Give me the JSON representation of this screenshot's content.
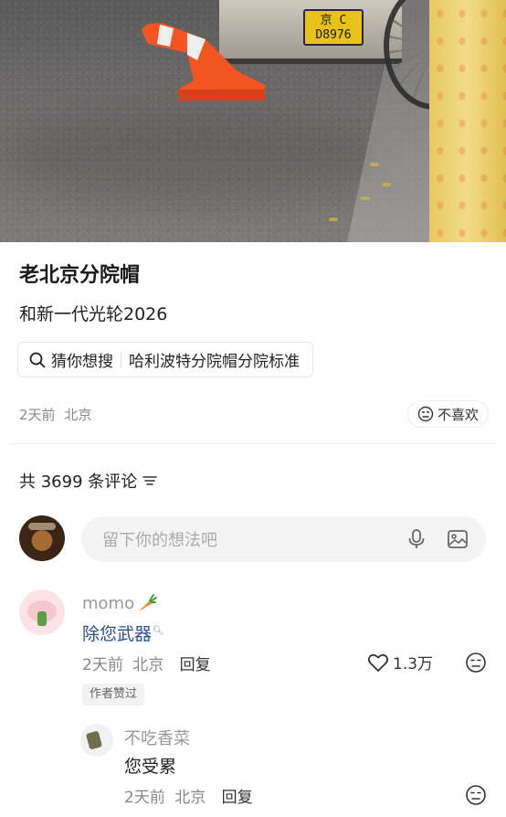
{
  "photo": {
    "plate_line1": "京 C",
    "plate_line2": "D8976",
    "cone_color": "#f2551f"
  },
  "post": {
    "title": "老北京分院帽",
    "body": "和新一代光轮2026",
    "search_chip": {
      "prefix": "猜你想搜",
      "query": "哈利波特分院帽分院标准"
    },
    "time": "2天前",
    "location": "北京",
    "dislike_label": "不喜欢"
  },
  "comments_header": {
    "count_label": "共 3699 条评论"
  },
  "comment_input": {
    "placeholder": "留下你的想法吧"
  },
  "comment": {
    "author": "momo",
    "text": "除您武器",
    "time": "2天前",
    "location": "北京",
    "reply_label": "回复",
    "likes": "1.3万",
    "badge": "作者赞过"
  },
  "reply": {
    "author": "不吃香菜",
    "text": "您受累",
    "time": "2天前",
    "location": "北京",
    "reply_label": "回复"
  },
  "colors": {
    "link_blue": "#2c4d8f",
    "muted": "#999999"
  }
}
